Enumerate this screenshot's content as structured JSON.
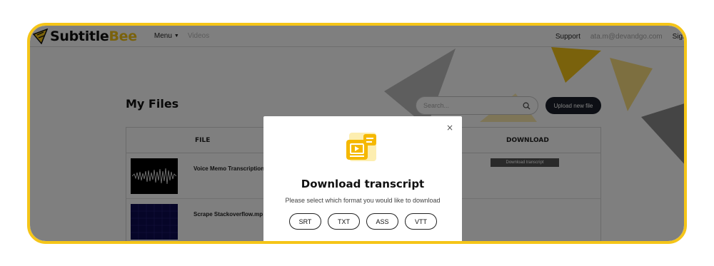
{
  "header": {
    "logo_part1": "Subtitle",
    "logo_part2": "Bee",
    "menu_label": "Menu",
    "videos_label": "Videos",
    "support_label": "Support",
    "user_email": "ata.m@devandgo.com",
    "signout_label": "Sign o"
  },
  "main": {
    "title": "My Files",
    "search_placeholder": "Search...",
    "upload_label": "Upload new file",
    "table": {
      "headers": {
        "file": "FILE",
        "download": "DOWNLOAD"
      },
      "rows": [
        {
          "name": "Voice Memo Transcription",
          "download_label": "Download transcript"
        },
        {
          "name": "Scrape Stackoverflow.mp"
        }
      ]
    }
  },
  "modal": {
    "title": "Download transcript",
    "subtitle": "Please select which format you would like to download",
    "formats": [
      "SRT",
      "TXT",
      "ASS",
      "VTT"
    ]
  },
  "colors": {
    "brand_yellow": "#f5c518",
    "dark_button": "#1b1f2a",
    "overlay": "rgba(0,0,0,0.5)"
  },
  "icons": [
    "logo-bee-icon",
    "menu-caret-icon",
    "search-icon",
    "close-icon",
    "download-transcript-icon"
  ]
}
